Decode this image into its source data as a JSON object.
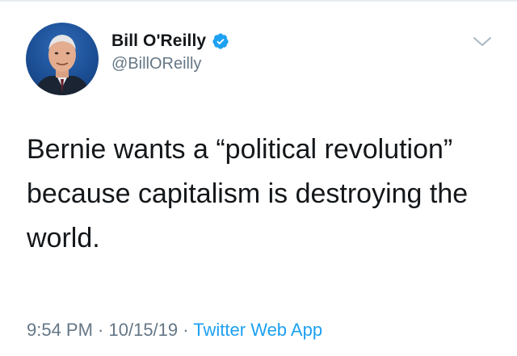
{
  "tweet": {
    "author": {
      "display_name": "Bill O'Reilly",
      "handle": "@BillOReilly",
      "verified": true,
      "avatar_icon": "profile-photo"
    },
    "text": "Bernie wants a “political revolution” because capitalism is destroying the world.",
    "meta": {
      "time": "9:54 PM",
      "separator": " · ",
      "date": "10/15/19",
      "source": "Twitter Web App"
    },
    "icons": {
      "verified": "verified-badge-icon",
      "menu": "chevron-down-icon"
    }
  },
  "colors": {
    "name": "#14171a",
    "secondary": "#657786",
    "link": "#1da1f2",
    "verified": "#1da1f2"
  }
}
